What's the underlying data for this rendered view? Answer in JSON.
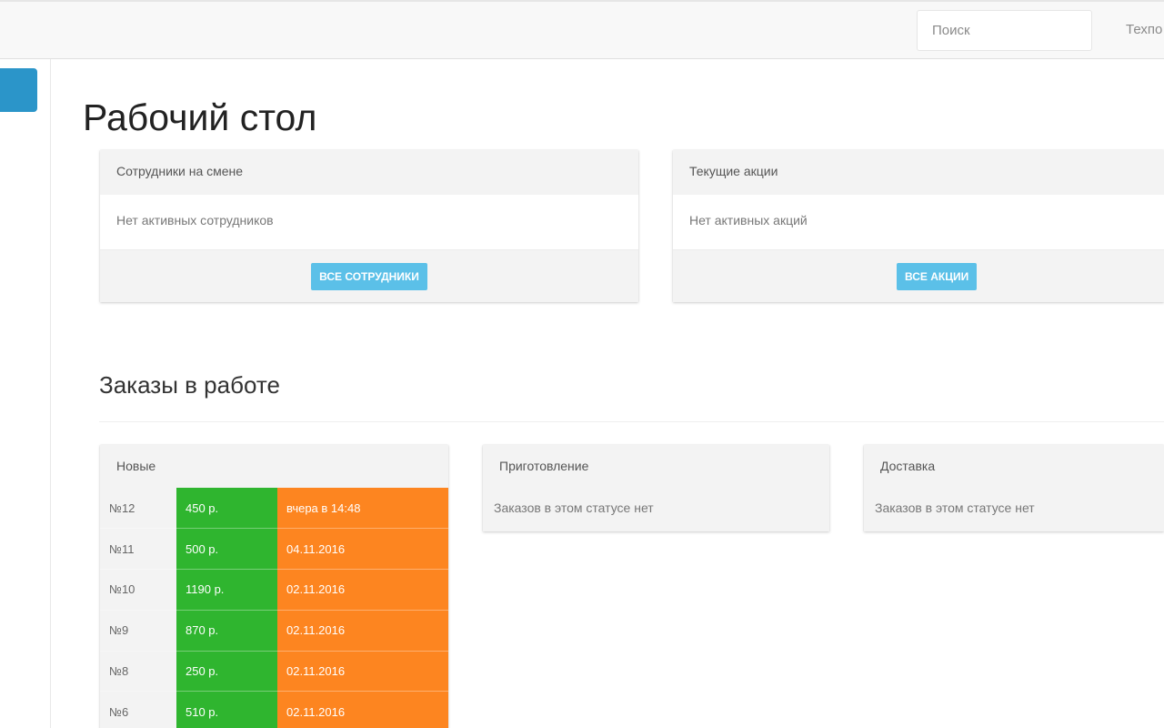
{
  "topbar": {
    "search_placeholder": "Поиск",
    "nav_link": "Техпо"
  },
  "page": {
    "title": "Рабочий стол"
  },
  "staff_panel": {
    "title": "Сотрудники на смене",
    "empty_text": "Нет активных сотрудников",
    "button_label": "ВСЕ СОТРУДНИКИ"
  },
  "promo_panel": {
    "title": "Текущие акции",
    "empty_text": "Нет активных акций",
    "button_label": "ВСЕ АКЦИИ"
  },
  "orders": {
    "section_title": "Заказы в работе",
    "columns": [
      {
        "title": "Новые",
        "rows": [
          {
            "number": "№12",
            "amount": "450 р.",
            "time": "вчера в 14:48"
          },
          {
            "number": "№11",
            "amount": "500 р.",
            "time": "04.11.2016"
          },
          {
            "number": "№10",
            "amount": "1190 р.",
            "time": "02.11.2016"
          },
          {
            "number": "№9",
            "amount": "870 р.",
            "time": "02.11.2016"
          },
          {
            "number": "№8",
            "amount": "250 р.",
            "time": "02.11.2016"
          },
          {
            "number": "№6",
            "amount": "510 р.",
            "time": "02.11.2016"
          }
        ]
      },
      {
        "title": "Приготовление",
        "empty_text": "Заказов в этом статусе нет"
      },
      {
        "title": "Доставка",
        "empty_text": "Заказов в этом статусе нет"
      }
    ]
  },
  "colors": {
    "accent": "#2b95c9",
    "button": "#5bc0e8",
    "amount_green": "#2fb52f",
    "date_orange": "#fd8520"
  }
}
